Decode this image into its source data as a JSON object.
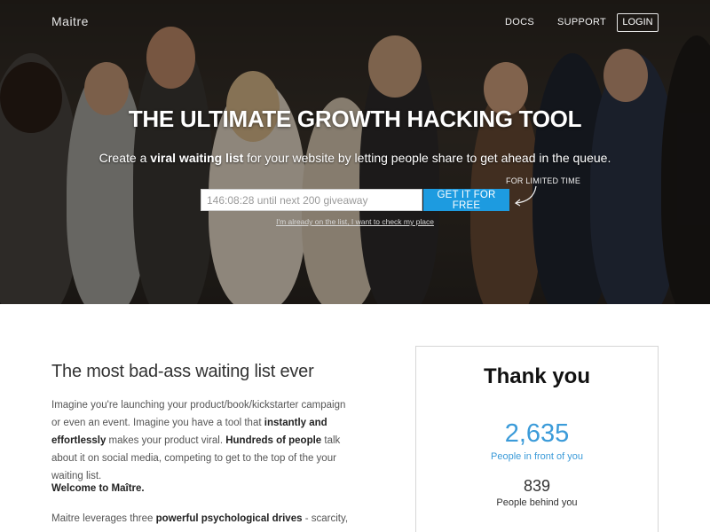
{
  "nav": {
    "brand": "Maitre",
    "docs": "DOCS",
    "support": "SUPPORT",
    "login": "LOGIN"
  },
  "hero": {
    "headline": "THE ULTIMATE GROWTH HACKING TOOL",
    "subline_pre": "Create a ",
    "subline_bold": "viral waiting list",
    "subline_post": " for your website by letting people share to get ahead in the queue.",
    "input_placeholder": "146:08:28 until next 200 giveaway",
    "cta": "GET IT FOR FREE",
    "limited": "FOR LIMITED TIME",
    "check_link": "I'm already on the list, I want to check my place"
  },
  "content": {
    "title": "The most bad-ass waiting list ever",
    "p1_a": "Imagine you're launching your product/book/kickstarter campaign or even an event. Imagine you have a tool that ",
    "p1_b": "instantly and effortlessly",
    "p1_c": " makes your product viral. ",
    "p1_d": "Hundreds of people",
    "p1_e": " talk about it on social media, competing to get to the top of the your waiting list.",
    "p2": "Welcome to Maître.",
    "p3_a": "Maitre leverages three ",
    "p3_b": "powerful psychological drives",
    "p3_c": " - scarcity,"
  },
  "card": {
    "title": "Thank you",
    "ahead_count": "2,635",
    "ahead_label": "People in front of you",
    "behind_count": "839",
    "behind_label": "People behind you"
  },
  "colors": {
    "accent": "#1d9be0",
    "stat_blue": "#3b9bd9"
  }
}
